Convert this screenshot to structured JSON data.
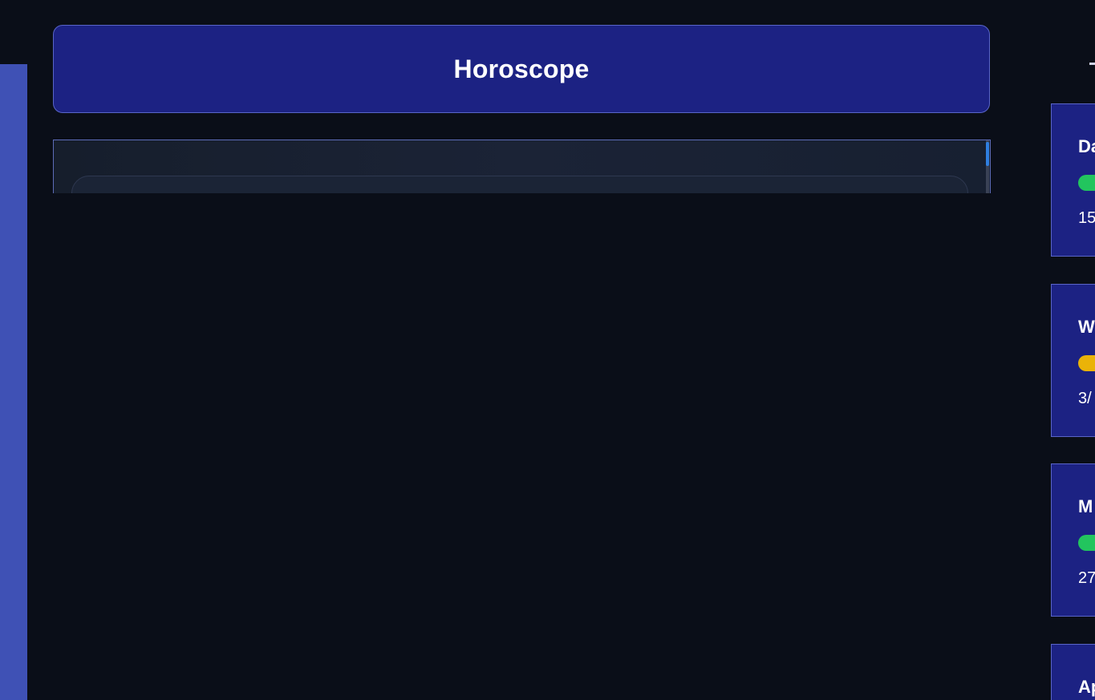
{
  "header": {
    "title": "Horoscope"
  },
  "side_cards": [
    {
      "title": "Da",
      "value": "15",
      "status_color": "#22c55e"
    },
    {
      "title": "W",
      "value": "3/",
      "status_color": "#eab308"
    },
    {
      "title": "M",
      "value": "27",
      "status_color": "#22c55e"
    },
    {
      "title": "Ap",
      "value": "",
      "status_color": ""
    }
  ],
  "colors": {
    "background": "#0a0e18",
    "accent": "#1c2283",
    "rail": "#3f51b5",
    "scroll_thumb": "#2f7fe0"
  }
}
